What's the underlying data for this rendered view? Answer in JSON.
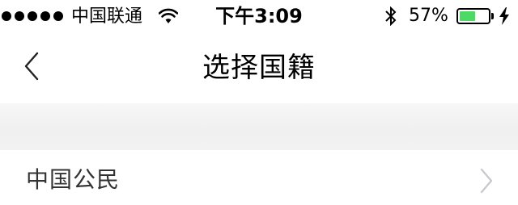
{
  "status_bar": {
    "signal_icon": "signal-dots-icon",
    "carrier": "中国联通",
    "wifi_icon": "wifi-icon",
    "time": "下午3:09",
    "bluetooth_icon": "bluetooth-icon",
    "battery_percent": "57%",
    "battery_level": 0.57,
    "battery_color": "#4cd964",
    "charging_icon": "bolt-icon"
  },
  "nav": {
    "back_icon": "chevron-left-icon",
    "title": "选择国籍"
  },
  "list": {
    "items": [
      {
        "label": "中国公民",
        "icon": "chevron-right-icon"
      }
    ]
  }
}
